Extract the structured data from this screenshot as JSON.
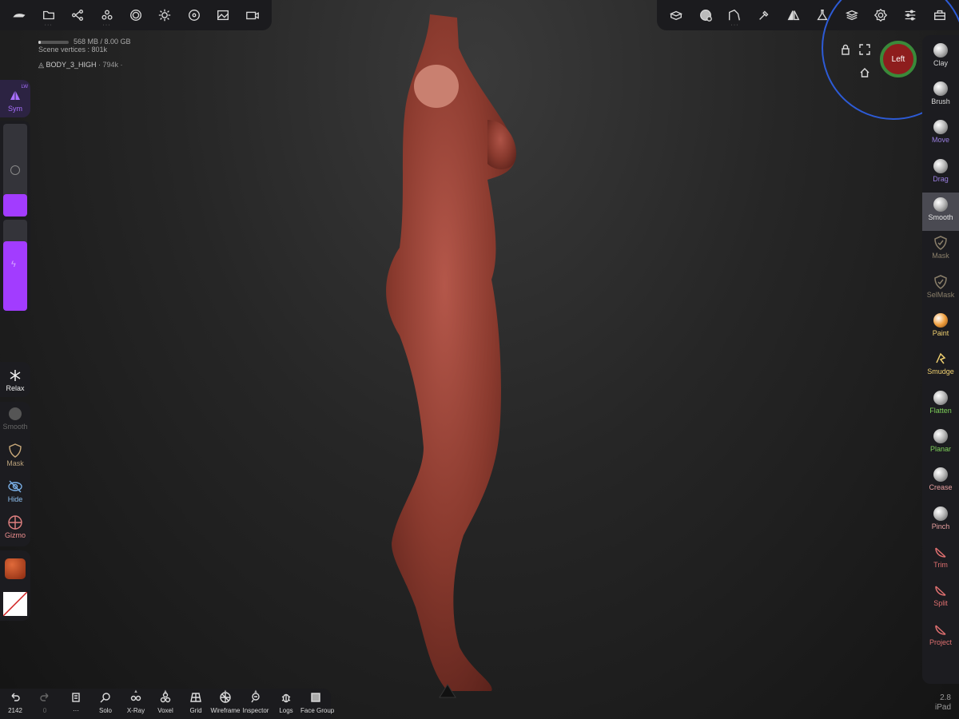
{
  "app": {
    "top_left_icons": [
      "nomad-logo-icon",
      "folder-icon",
      "nodes-icon",
      "cluster-icon",
      "sphere-icon",
      "sun-icon",
      "film-icon",
      "image-icon",
      "camera-icon"
    ],
    "top_right_icons": [
      "cube-stack-icon",
      "brush-stamp-icon",
      "topology-icon",
      "picker-icon",
      "symmetry-icon",
      "flask-icon",
      "layers-icon",
      "settings-icon",
      "sliders-icon",
      "toolbox-icon"
    ]
  },
  "scene": {
    "memory": "568 MB / 8.00 GB",
    "memory_fraction": 0.08,
    "vertices": "Scene vertices : 801k",
    "mesh_name": "BODY_3_HIGH",
    "mesh_sub": "· 794k ·"
  },
  "left": {
    "sym_label": "Sym",
    "lw_label": "LW",
    "radius_fraction": 0.24,
    "intensity_fraction": 0.76,
    "relax": "Relax",
    "smooth": "Smooth",
    "mask": "Mask",
    "hide": "Hide",
    "gizmo": "Gizmo"
  },
  "nav": {
    "cube_label": "Left"
  },
  "right_tools": [
    {
      "label": "Clay",
      "color": "#d8d8d8",
      "kind": "ball"
    },
    {
      "label": "Brush",
      "color": "#d8d8d8",
      "kind": "ball"
    },
    {
      "label": "Move",
      "color": "#9a7fe0",
      "kind": "ball"
    },
    {
      "label": "Drag",
      "color": "#9a7fe0",
      "kind": "ball"
    },
    {
      "label": "Smooth",
      "color": "#e6e6e6",
      "kind": "ball"
    },
    {
      "label": "Mask",
      "color": "#8a7f6a",
      "kind": "shield"
    },
    {
      "label": "SelMask",
      "color": "#8a7f6a",
      "kind": "shield"
    },
    {
      "label": "Paint",
      "color": "#f0d070",
      "kind": "ball"
    },
    {
      "label": "Smudge",
      "color": "#f0d070",
      "kind": "smudge"
    },
    {
      "label": "Flatten",
      "color": "#7ed05a",
      "kind": "ball"
    },
    {
      "label": "Planar",
      "color": "#7ed05a",
      "kind": "ball"
    },
    {
      "label": "Crease",
      "color": "#e8a0a0",
      "kind": "ball"
    },
    {
      "label": "Pinch",
      "color": "#e8a0a0",
      "kind": "ball"
    },
    {
      "label": "Trim",
      "color": "#e07070",
      "kind": "trim"
    },
    {
      "label": "Split",
      "color": "#e07070",
      "kind": "trim"
    },
    {
      "label": "Project",
      "color": "#e07070",
      "kind": "trim"
    }
  ],
  "version": {
    "number": "2.8",
    "device": "iPad"
  },
  "bottom": {
    "undo_count": "2142",
    "redo_count": "0",
    "more": "···",
    "solo": "Solo",
    "xray": "X-Ray",
    "voxel": "Voxel",
    "grid": "Grid",
    "wireframe": "Wireframe",
    "inspector": "Inspector",
    "logs": "Logs",
    "facegroup": "Face Group"
  },
  "colors": {
    "accent": "#a23cff",
    "nav_ring": "#2d5bd6",
    "model": "#8a3a2e"
  }
}
